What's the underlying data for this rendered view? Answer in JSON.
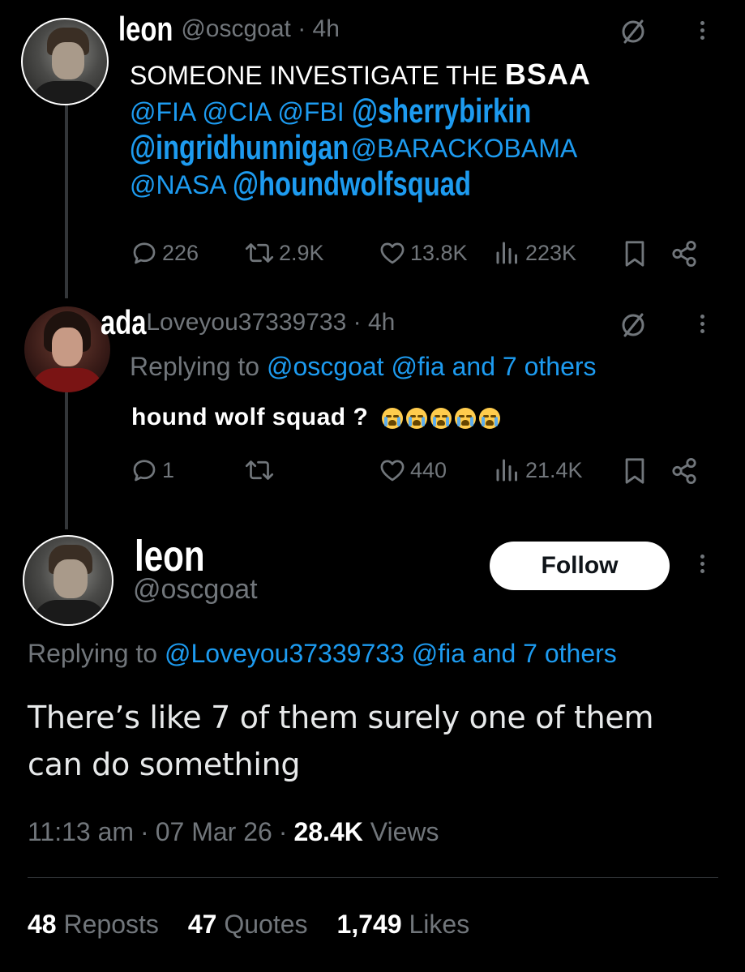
{
  "tweet1": {
    "display_name": "leon",
    "handle": "@oscgoat",
    "sep": " · ",
    "time": "4h",
    "text_line1": "SOMEONE INVESTIGATE THE ",
    "text_bold": "BSAA",
    "mentions_line2": [
      "@FIA",
      "@CIA",
      "@FBI"
    ],
    "mention_bold_1": "@sherrybirkin",
    "mention_bold_2": "@ingridhunnigan",
    "mention_line3": "@BARACKOBAMA",
    "mention_line4": "@NASA",
    "mention_bold_3": "@houndwolfsquad",
    "replies": "226",
    "reposts": "2.9K",
    "likes": "13.8K",
    "views": "223K"
  },
  "tweet2": {
    "display_name": "ada",
    "handle": "Loveyou37339733",
    "sep": " · ",
    "time": "4h",
    "replying_prefix": "Replying to ",
    "replying_mentions": "@oscgoat @fia and 7 others",
    "text": "hound wolf squad ?",
    "emoji_name": "loudly-crying-face",
    "emoji_count": 5,
    "replies": "1",
    "likes": "440",
    "views": "21.4K"
  },
  "main": {
    "display_name": "leon",
    "handle": "@oscgoat",
    "follow_label": "Follow",
    "replying_prefix": "Replying to ",
    "replying_mentions": "@Loveyou37339733 @fia and 7 others",
    "text_line1": "There’s like 7 of them surely one of them",
    "text_line2": "can do something",
    "time": "11:13 am",
    "date": "07 Mar 26",
    "views_count": "28.4K",
    "views_label": " Views",
    "reposts_count": "48",
    "reposts_label": " Reposts",
    "quotes_count": "47",
    "quotes_label": " Quotes",
    "likes_count": "1,749",
    "likes_label": " Likes"
  },
  "colors": {
    "background": "#000000",
    "link": "#1d9bf0",
    "muted": "#71767b",
    "text": "#e7e9ea"
  }
}
